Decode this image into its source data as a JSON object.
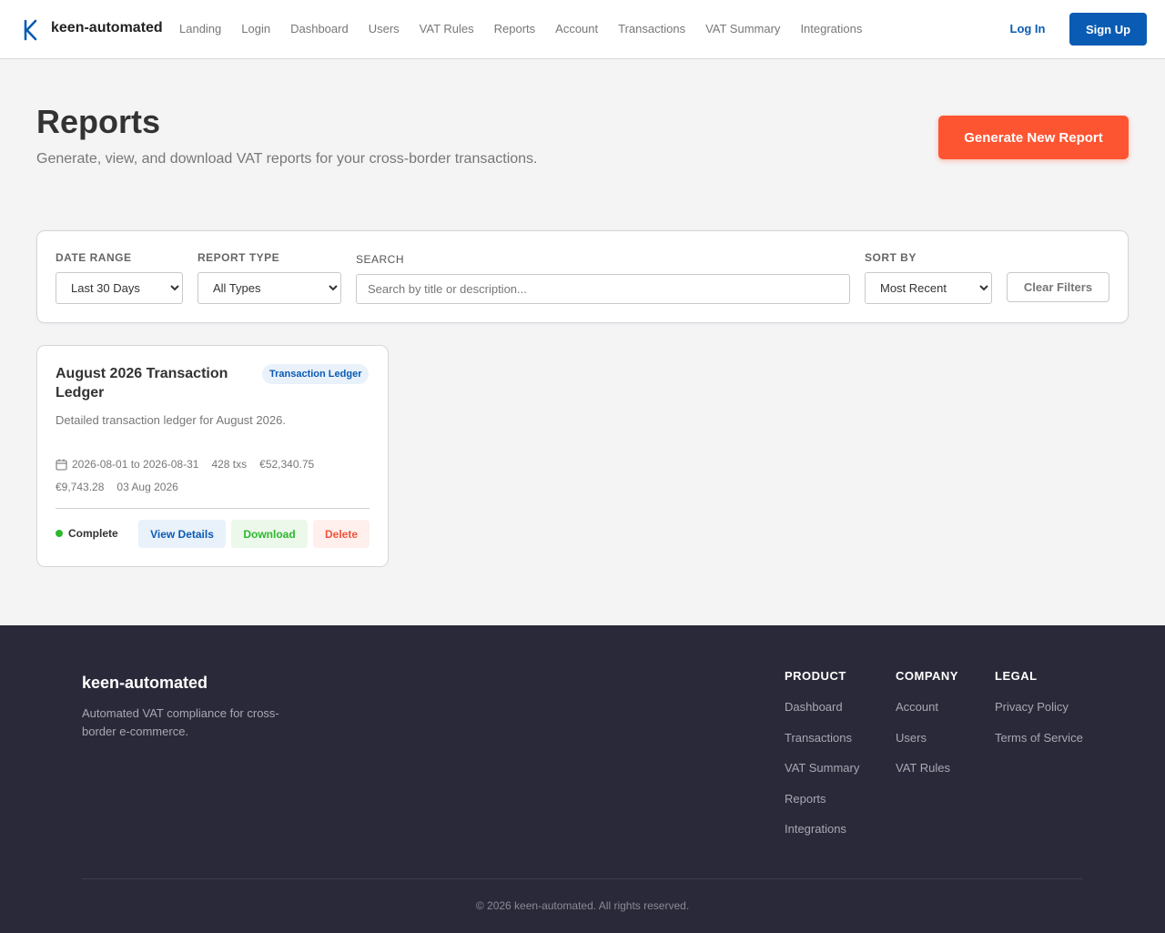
{
  "header": {
    "brand": "keen-automated",
    "logo_icon": "k-logo-icon",
    "nav": [
      "Landing",
      "Login",
      "Dashboard",
      "Users",
      "VAT Rules",
      "Reports",
      "Account",
      "Transactions",
      "VAT Summary",
      "Integrations"
    ],
    "login_label": "Log In",
    "signup_label": "Sign Up"
  },
  "page": {
    "title": "Reports",
    "subtitle": "Generate, view, and download VAT reports for your cross-border transactions.",
    "generate_label": "Generate New Report"
  },
  "filters": {
    "date_range": {
      "label": "DATE RANGE",
      "value": "Last 30 Days"
    },
    "report_type": {
      "label": "REPORT TYPE",
      "value": "All Types"
    },
    "search": {
      "label": "SEARCH",
      "placeholder": "Search by title or description..."
    },
    "sort_by": {
      "label": "SORT BY",
      "value": "Most Recent"
    },
    "clear_label": "Clear Filters"
  },
  "reports": [
    {
      "title": "August 2026 Transaction Ledger",
      "badge": "Transaction Ledger",
      "description": "Detailed transaction ledger for August 2026.",
      "period": "2026-08-01 to 2026-08-31",
      "tx_count": "428 txs",
      "total": "€52,340.75",
      "vat": "€9,743.28",
      "created": "03 Aug 2026",
      "status": "Complete",
      "view_label": "View Details",
      "download_label": "Download",
      "delete_label": "Delete"
    }
  ],
  "footer": {
    "brand": "keen-automated",
    "tagline": "Automated VAT compliance for cross-border e-commerce.",
    "columns": [
      {
        "title": "PRODUCT",
        "links": [
          "Dashboard",
          "Transactions",
          "VAT Summary",
          "Reports",
          "Integrations"
        ]
      },
      {
        "title": "COMPANY",
        "links": [
          "Account",
          "Users",
          "VAT Rules"
        ]
      },
      {
        "title": "LEGAL",
        "links": [
          "Privacy Policy",
          "Terms of Service"
        ]
      }
    ],
    "copyright": "© 2026 keen-automated. All rights reserved."
  },
  "colors": {
    "primary": "#0a5bb3",
    "accent": "#fd5532",
    "success": "#2eb82e",
    "danger": "#f0533a",
    "footer_bg": "#2a2939"
  }
}
